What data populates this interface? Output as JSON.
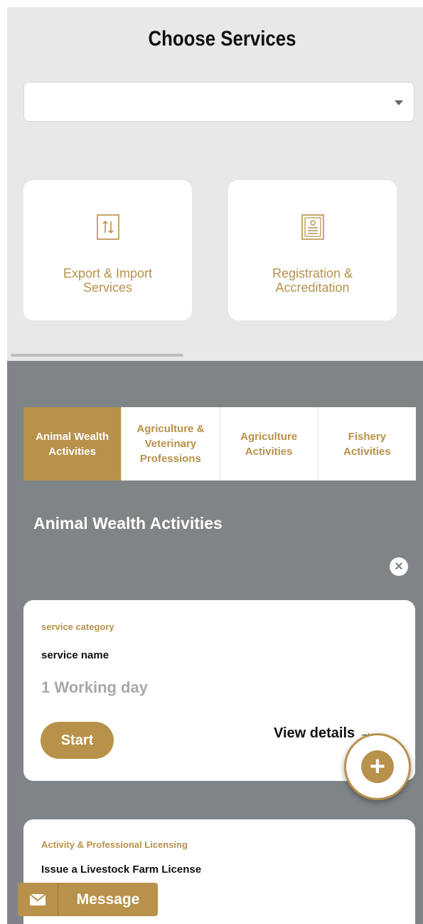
{
  "header": {
    "title": "Choose Services"
  },
  "service_select": {
    "value": ""
  },
  "service_cards": [
    {
      "label_lines": [
        "Export & Import",
        "Services"
      ],
      "icon": "export-import-icon"
    },
    {
      "label_lines": [
        "Registration &",
        "Accreditation"
      ],
      "icon": "certificate-icon"
    }
  ],
  "tabs": [
    {
      "label_lines": [
        "Animal Wealth",
        "Activities"
      ],
      "active": true
    },
    {
      "label_lines": [
        "Agriculture &",
        "Veterinary",
        "Professions"
      ],
      "active": false
    },
    {
      "label_lines": [
        "Agriculture",
        "Activities"
      ],
      "active": false
    },
    {
      "label_lines": [
        "Fishery",
        "Activities"
      ],
      "active": false
    }
  ],
  "section": {
    "title": "Animal Wealth Activities"
  },
  "services": [
    {
      "category": "service category",
      "name": "service name",
      "duration": "1 Working day",
      "start_label": "Start",
      "details_label": "View details"
    },
    {
      "category": "Activity & Professional Licensing",
      "name": "Issue a Livestock Farm License"
    }
  ],
  "message_button": {
    "label": "Message"
  },
  "colors": {
    "accent": "#b8914a",
    "panel_bg": "#e7e8e9",
    "dark_bg": "#7f8487"
  }
}
